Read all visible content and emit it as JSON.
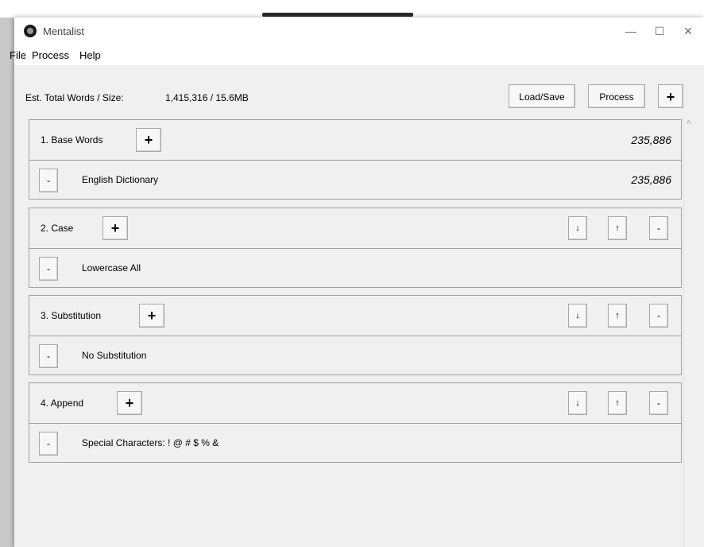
{
  "window": {
    "title": "Mentalist"
  },
  "window_controls": {
    "minimize": "—",
    "maximize": "☐",
    "close": "✕"
  },
  "menu": [
    "File",
    "Process",
    "Help"
  ],
  "toolbar": {
    "size_label": "Est. Total Words / Size:",
    "size_value": "1,415,316 / 15.6MB",
    "load_save_label": "Load/Save",
    "process_label": "Process",
    "add_label": "+"
  },
  "sections": [
    {
      "title": "1. Base Words",
      "count": "235,886",
      "item": {
        "label": "English Dictionary",
        "count": "235,886"
      }
    },
    {
      "title": "2. Case",
      "item": {
        "label": "Lowercase All"
      }
    },
    {
      "title": "3. Substitution",
      "item": {
        "label": "No Substitution"
      }
    },
    {
      "title": "4. Append",
      "item": {
        "label": "Special Characters: ! @ # $ % &"
      }
    }
  ],
  "buttons": {
    "add": "+",
    "remove": "-",
    "move_down": "↓",
    "move_up": "↑"
  },
  "scrollbar": {
    "up_arrow": "^"
  }
}
